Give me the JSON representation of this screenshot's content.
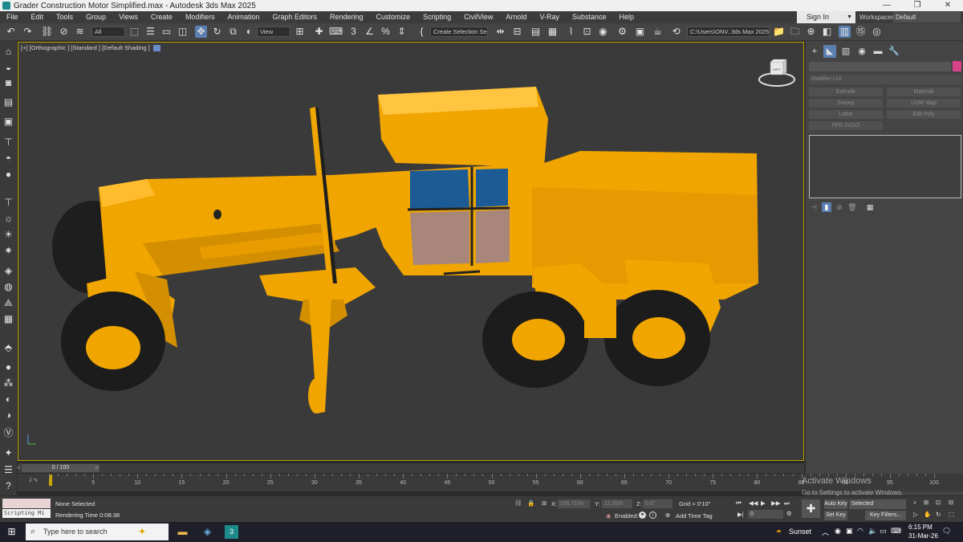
{
  "window": {
    "title": "Grader Construction Motor Simplified.max - Autodesk 3ds Max 2025",
    "minimize": "—",
    "maximize": "❐",
    "close": "✕"
  },
  "menu": [
    "File",
    "Edit",
    "Tools",
    "Group",
    "Views",
    "Create",
    "Modifiers",
    "Animation",
    "Graph Editors",
    "Rendering",
    "Customize",
    "Scripting",
    "CivilView",
    "Arnold",
    "V-Ray",
    "Substance",
    "Help"
  ],
  "account": {
    "signin": "Sign In",
    "workspaces_label": "Workspaces:",
    "workspace": "Default"
  },
  "toolbar": {
    "selection_filter": "All",
    "ref_coord": "View",
    "selection_set": "Create Selection Se",
    "project_path": "C:\\Users\\ONV..3ds Max 2025"
  },
  "viewport": {
    "label": "[+] [Orthographic ] [Standard ] [Default Shading ]",
    "viewcube_face": "LEFT"
  },
  "command_panel": {
    "modifier_list": "Modifier List",
    "buttons": [
      "Extrude",
      "Material",
      "Sweep",
      "UVW Map",
      "Lathe",
      "Edit Poly",
      "FFD 2x2x2"
    ]
  },
  "timeline": {
    "frame_display": "0 / 100",
    "ticks": [
      "5",
      "10",
      "15",
      "20",
      "25",
      "30",
      "35",
      "40",
      "45",
      "50",
      "55",
      "60",
      "65",
      "70",
      "75",
      "80",
      "85",
      "90",
      "95",
      "100"
    ]
  },
  "status": {
    "script_label": "Scripting Mi",
    "selection": "None Selected",
    "render_time": "Rendering Time  0:08:38",
    "x_label": "X:",
    "x_value": "195.71/m",
    "y_label": "Y:",
    "y_value": "12.35/0",
    "z_label": "Z:",
    "z_value": "0.0\"",
    "grid": "Grid = 0'10\"",
    "enabled": "Enabled:",
    "add_time_tag": "Add Time Tag",
    "auto_key": "Auto Key",
    "set_key": "Set Key",
    "key_mode": "Selected",
    "key_filters": "Key Filters...",
    "frame_value": "0",
    "activate_title": "Activate Windows",
    "activate_sub": "Go to Settings to activate Windows."
  },
  "taskbar": {
    "search_placeholder": "Type here to search",
    "weather": "Sunset",
    "time": "6:15 PM",
    "date": "31-Mar-26"
  }
}
